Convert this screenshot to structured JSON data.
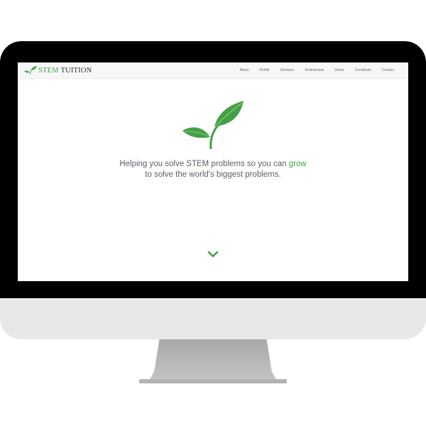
{
  "brand": {
    "name_part1": "STEM",
    "name_part2": " TUITION",
    "logo_icon": "leaf-icon"
  },
  "nav": {
    "items": [
      {
        "label": "About"
      },
      {
        "label": "Profile"
      },
      {
        "label": "Services"
      },
      {
        "label": "Testimonials"
      },
      {
        "label": "Demo"
      },
      {
        "label": "Contribute"
      },
      {
        "label": "Contact"
      }
    ]
  },
  "hero": {
    "icon": "sprout-icon",
    "text_before": "Helping you solve STEM problems so you can ",
    "text_highlight": "grow",
    "text_after": " to solve the world's biggest problems.",
    "scroll_icon": "chevron-down-icon"
  },
  "colors": {
    "accent": "#43a047",
    "bezel": "#000000",
    "chin": "#e8e8e8",
    "text": "#5e5e6a"
  }
}
